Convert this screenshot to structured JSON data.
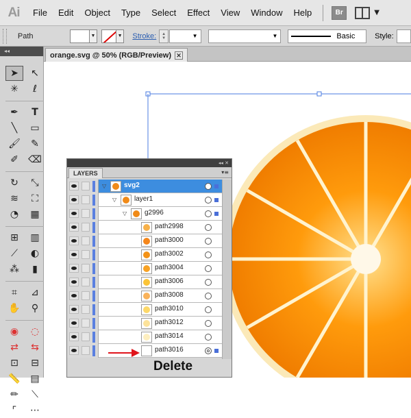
{
  "app": {
    "logo": "Ai"
  },
  "menu": [
    "File",
    "Edit",
    "Object",
    "Type",
    "Select",
    "Effect",
    "View",
    "Window",
    "Help"
  ],
  "menu_right": {
    "bridge_label": "Br",
    "workspace_icon": "workspace-layout-icon"
  },
  "control_bar": {
    "selection_label": "Path",
    "stroke_label": "Stroke:",
    "brush_label": "Basic",
    "style_label": "Style:"
  },
  "document": {
    "tab_title": "orange.svg @ 50% (RGB/Preview)",
    "close_glyph": "✕"
  },
  "layers_panel": {
    "tab_label": "LAYERS",
    "rows": [
      {
        "name": "svg2",
        "level": 0,
        "expanded": true,
        "selected": true,
        "thumb_color": "#f08a18"
      },
      {
        "name": "layer1",
        "level": 1,
        "expanded": true,
        "selected": false,
        "thumb_color": "#f08a18"
      },
      {
        "name": "g2996",
        "level": 2,
        "expanded": true,
        "selected": false,
        "thumb_color": "#f08a18"
      },
      {
        "name": "path2998",
        "level": 3,
        "selected": false,
        "thumb_color": "#f7b14a"
      },
      {
        "name": "path3000",
        "level": 3,
        "selected": false,
        "thumb_color": "#f5861a"
      },
      {
        "name": "path3002",
        "level": 3,
        "selected": false,
        "thumb_color": "#f39217"
      },
      {
        "name": "path3004",
        "level": 3,
        "selected": false,
        "thumb_color": "#f8a224"
      },
      {
        "name": "path3006",
        "level": 3,
        "selected": false,
        "thumb_color": "#fbc437"
      },
      {
        "name": "path3008",
        "level": 3,
        "selected": false,
        "thumb_color": "#f9b25a"
      },
      {
        "name": "path3010",
        "level": 3,
        "selected": false,
        "thumb_color": "#fcd86a"
      },
      {
        "name": "path3012",
        "level": 3,
        "selected": false,
        "thumb_color": "#fde39a"
      },
      {
        "name": "path3014",
        "level": 3,
        "selected": false,
        "thumb_color": "#fdeebf"
      },
      {
        "name": "path3016",
        "level": 3,
        "selected": false,
        "thumb_color": "#ffffff"
      }
    ]
  },
  "annotation": {
    "label": "Delete",
    "color": "#e0141b"
  }
}
